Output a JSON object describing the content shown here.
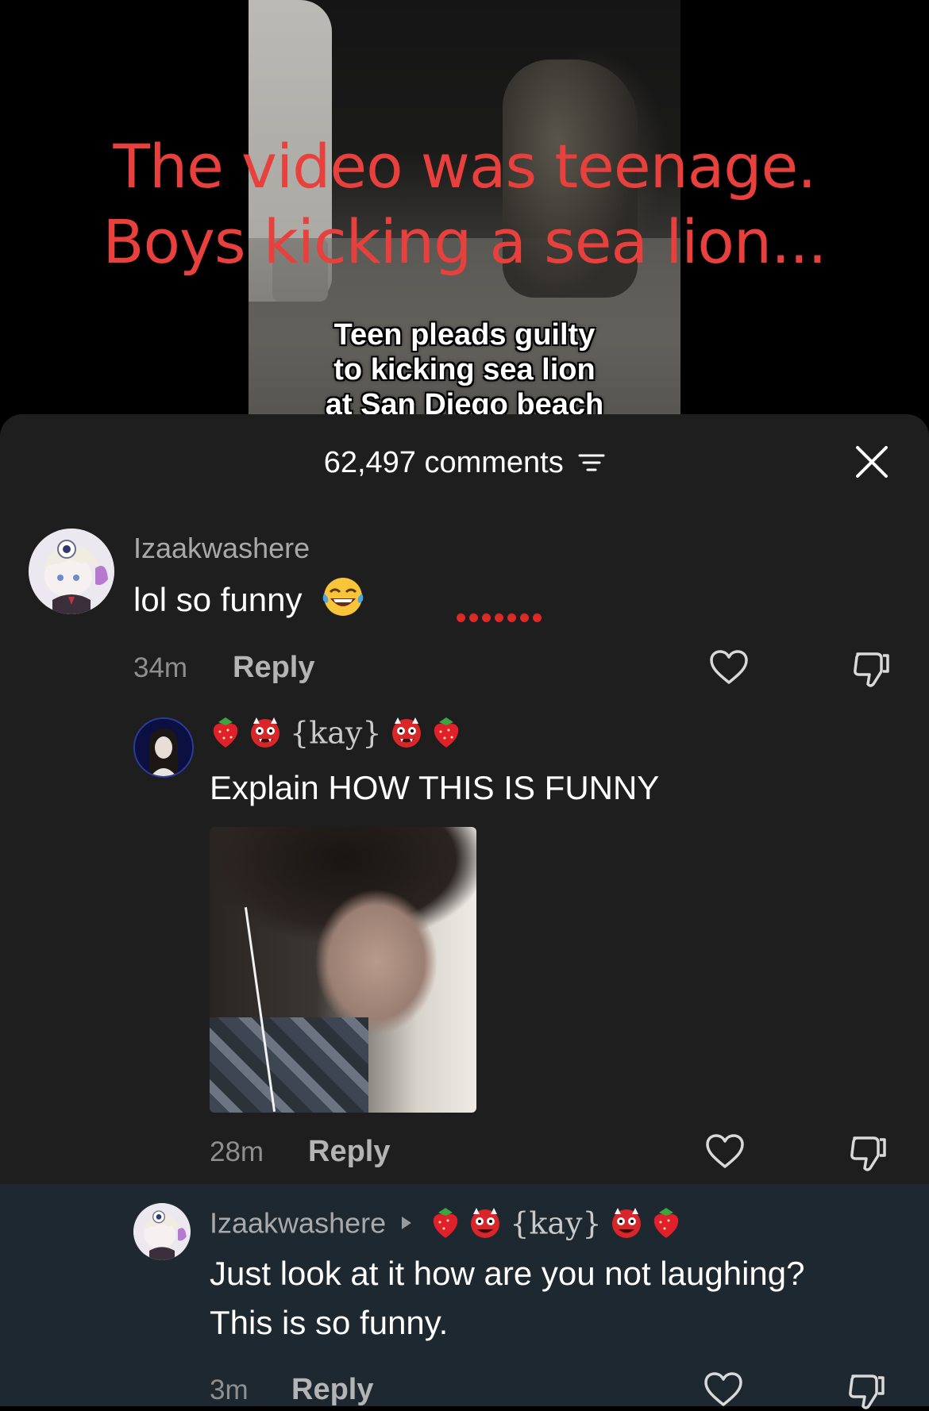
{
  "video": {
    "overlay_title_lines": [
      "The video was teenage.",
      "Boys kicking a sea lion..."
    ],
    "caption_lines": [
      "Teen pleads guilty",
      "to kicking sea lion",
      "at San Diego beach"
    ]
  },
  "comments_header": {
    "count_label": "62,497 comments"
  },
  "comments": [
    {
      "username": "Izaakwashere",
      "text": "lol so funny",
      "time": "34m",
      "reply_label": "Reply"
    },
    {
      "username_text": "{kay}",
      "text": "Explain HOW THIS IS FUNNY",
      "time": "28m",
      "reply_label": "Reply"
    },
    {
      "username": "Izaakwashere",
      "reply_to_text": "{kay}",
      "text_lines": [
        "Just look at it how are you not laughing?",
        "This is so funny."
      ],
      "time": "3m",
      "reply_label": "Reply"
    }
  ],
  "colors": {
    "title_red": "#e8403c",
    "sheet_bg": "#1e1e1e",
    "highlight_bg": "#1d2830",
    "dots_red": "#e02828"
  },
  "icons": [
    "filter-icon",
    "close-icon",
    "heart-icon",
    "dislike-icon",
    "laughing-emoji",
    "strawberry-emoji",
    "ogre-emoji",
    "play-arrow-icon"
  ]
}
